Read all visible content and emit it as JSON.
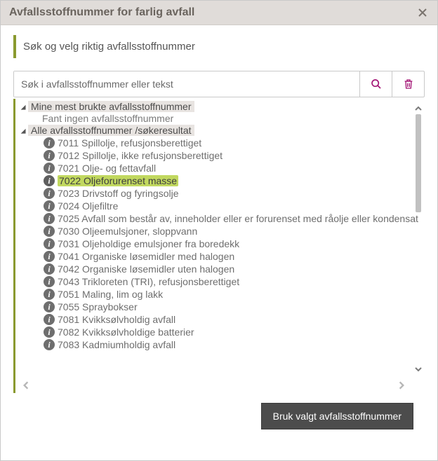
{
  "dialog": {
    "title": "Avfallsstoffnummer for farlig avfall",
    "close_label": "Close"
  },
  "instruction": "Søk og velg riktig avfallsstoffnummer",
  "search": {
    "placeholder": "Søk i avfallsstoffnummer eller tekst",
    "search_button": "Søk",
    "clear_button": "Tøm"
  },
  "tree": {
    "recent": {
      "label": "Mine mest brukte avfallsstoffnummer",
      "empty_message": "Fant ingen avfallsstoffnummer"
    },
    "all": {
      "label": "Alle avfallsstoffnummer /søkeresultat",
      "items": [
        {
          "code": "7011",
          "text": "Spillolje, refusjonsberettiget",
          "selected": false
        },
        {
          "code": "7012",
          "text": "Spillolje, ikke refusjonsberettiget",
          "selected": false
        },
        {
          "code": "7021",
          "text": "Olje- og fettavfall",
          "selected": false
        },
        {
          "code": "7022",
          "text": "Oljeforurenset masse",
          "selected": true
        },
        {
          "code": "7023",
          "text": "Drivstoff og fyringsolje",
          "selected": false
        },
        {
          "code": "7024",
          "text": "Oljefiltre",
          "selected": false
        },
        {
          "code": "7025",
          "text": "Avfall som består av, inneholder eller er forurenset med råolje eller kondensat",
          "selected": false
        },
        {
          "code": "7030",
          "text": "Oljeemulsjoner, sloppvann",
          "selected": false
        },
        {
          "code": "7031",
          "text": "Oljeholdige emulsjoner fra boredekk",
          "selected": false
        },
        {
          "code": "7041",
          "text": "Organiske løsemidler med halogen",
          "selected": false
        },
        {
          "code": "7042",
          "text": "Organiske løsemidler uten halogen",
          "selected": false
        },
        {
          "code": "7043",
          "text": "Trikloreten (TRI), refusjonsberettiget",
          "selected": false
        },
        {
          "code": "7051",
          "text": "Maling, lim og lakk",
          "selected": false
        },
        {
          "code": "7055",
          "text": "Spraybokser",
          "selected": false
        },
        {
          "code": "7081",
          "text": "Kvikksølvholdig avfall",
          "selected": false
        },
        {
          "code": "7082",
          "text": "Kvikksølvholdige batterier",
          "selected": false
        },
        {
          "code": "7083",
          "text": "Kadmiumholdig avfall",
          "selected": false
        }
      ]
    }
  },
  "footer": {
    "apply_button": "Bruk valgt avfallsstoffnummer"
  }
}
